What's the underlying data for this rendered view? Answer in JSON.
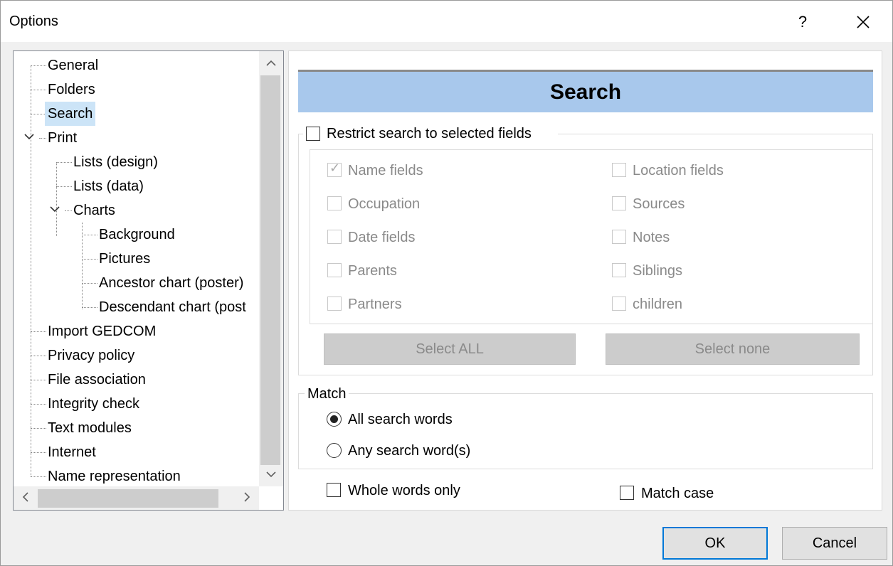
{
  "window": {
    "title": "Options",
    "help_label": "?",
    "close_label": "✕"
  },
  "tree": {
    "items": [
      {
        "label": "General"
      },
      {
        "label": "Folders"
      },
      {
        "label": "Search"
      },
      {
        "label": "Print"
      },
      {
        "label": "Lists (design)"
      },
      {
        "label": "Lists (data)"
      },
      {
        "label": "Charts"
      },
      {
        "label": "Background"
      },
      {
        "label": "Pictures"
      },
      {
        "label": "Ancestor chart (poster)"
      },
      {
        "label": "Descendant chart (post"
      },
      {
        "label": "Import GEDCOM"
      },
      {
        "label": "Privacy policy"
      },
      {
        "label": "File association"
      },
      {
        "label": "Integrity check"
      },
      {
        "label": "Text modules"
      },
      {
        "label": "Internet"
      },
      {
        "label": "Name representation"
      }
    ],
    "selected": "Search",
    "expanded_icon": "chevron-down",
    "scroll_up": "⌃",
    "scroll_down": "⌄",
    "scroll_left": "<",
    "scroll_right": ">"
  },
  "panel": {
    "header": "Search",
    "restrict": {
      "label": "Restrict search to selected fields",
      "checked": false
    },
    "fields_left": [
      {
        "label": "Name fields",
        "checked": true
      },
      {
        "label": "Occupation",
        "checked": false
      },
      {
        "label": "Date fields",
        "checked": false
      },
      {
        "label": "Parents",
        "checked": false
      },
      {
        "label": "Partners",
        "checked": false
      }
    ],
    "fields_right": [
      {
        "label": "Location fields",
        "checked": false
      },
      {
        "label": "Sources",
        "checked": false
      },
      {
        "label": "Notes",
        "checked": false
      },
      {
        "label": "Siblings",
        "checked": false
      },
      {
        "label": "children",
        "checked": false
      }
    ],
    "select_all_label": "Select ALL",
    "select_none_label": "Select none",
    "match": {
      "title": "Match",
      "all_label": "All search words",
      "any_label": "Any search word(s)",
      "selected": "all"
    },
    "whole_words_label": "Whole words only",
    "match_case_label": "Match case"
  },
  "buttons": {
    "ok": "OK",
    "cancel": "Cancel"
  },
  "colors": {
    "header_bg": "#a8c8ec",
    "selection_bg": "#cce4f7",
    "default_button_border": "#0078d7"
  }
}
